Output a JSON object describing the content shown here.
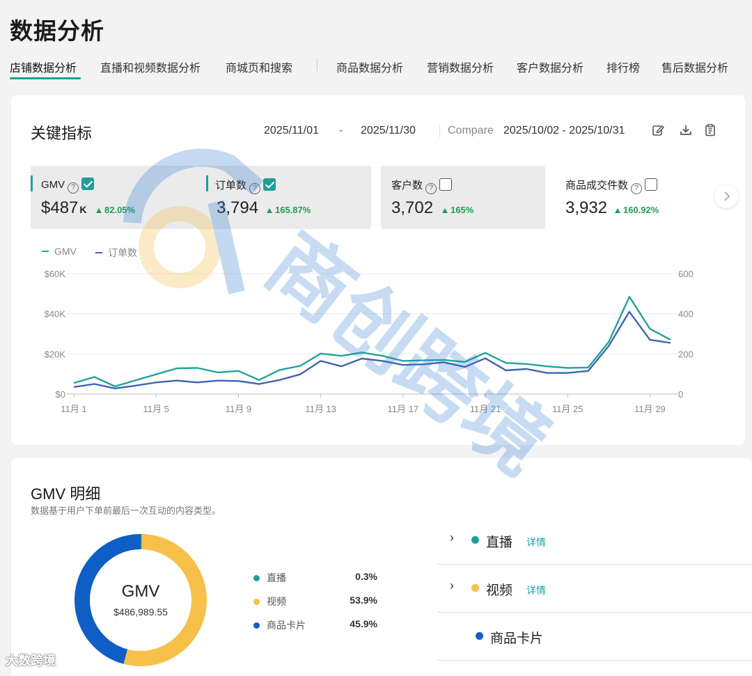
{
  "page": {
    "title": "数据分析"
  },
  "tabs": [
    {
      "label": "店铺数据分析"
    },
    {
      "label": "直播和视频数据分析"
    },
    {
      "label": "商城页和搜索"
    },
    {
      "label": "商品数据分析"
    },
    {
      "label": "营销数据分析"
    },
    {
      "label": "客户数据分析"
    },
    {
      "label": "排行榜"
    },
    {
      "label": "售后数据分析"
    }
  ],
  "key_metrics": {
    "title": "关键指标",
    "date_start": "2025/11/01",
    "date_dash": "-",
    "date_end": "2025/11/30",
    "compare_label": "Compare",
    "compare_range": "2025/10/02 - 2025/10/31",
    "icons": [
      "edit-icon",
      "download-icon",
      "clipboard-icon"
    ],
    "metrics": [
      {
        "label": "GMV",
        "value": "$487",
        "unit": "K",
        "delta": "82.05%",
        "checked": true,
        "selected": true
      },
      {
        "label": "订单数",
        "value": "3,794",
        "unit": "",
        "delta": "165.87%",
        "checked": true,
        "selected": true
      },
      {
        "label": "客户数",
        "value": "3,702",
        "unit": "",
        "delta": "165%",
        "checked": false,
        "selected": true
      },
      {
        "label": "商品成交件数",
        "value": "3,932",
        "unit": "",
        "delta": "160.92%",
        "checked": false,
        "selected": false
      }
    ],
    "help_glyph": "?"
  },
  "colors": {
    "accent": "#1f9e99",
    "gmv_line": "#22a39a",
    "orders_line": "#3f63b4",
    "positive": "#1d9e56",
    "live": "#1f9e99",
    "video": "#f7c04a",
    "product_card": "#0e5ec5"
  },
  "chart_data": {
    "type": "line",
    "legend": [
      "GMV",
      "订单数"
    ],
    "x": [
      "11月 1",
      "11月 2",
      "11月 3",
      "11月 4",
      "11月 5",
      "11月 6",
      "11月 7",
      "11月 8",
      "11月 9",
      "11月 10",
      "11月 11",
      "11月 12",
      "11月 13",
      "11月 14",
      "11月 15",
      "11月 16",
      "11月 17",
      "11月 18",
      "11月 19",
      "11月 20",
      "11月 21",
      "11月 22",
      "11月 23",
      "11月 24",
      "11月 25",
      "11月 26",
      "11月 27",
      "11月 28",
      "11月 29",
      "11月 30"
    ],
    "x_tick_labels": [
      "11月 1",
      "11月 5",
      "11月 9",
      "11月 13",
      "11月 17",
      "11月 21",
      "11月 25",
      "11月 29"
    ],
    "series": [
      {
        "name": "GMV",
        "axis": "left",
        "values": [
          5500,
          8500,
          3800,
          6800,
          9800,
          12800,
          13000,
          10800,
          11500,
          7000,
          12000,
          14000,
          20200,
          19000,
          20700,
          19000,
          16500,
          16800,
          17000,
          16000,
          20500,
          15500,
          15000,
          13800,
          13000,
          13200,
          26000,
          48500,
          32500,
          27000
        ]
      },
      {
        "name": "订单数",
        "axis": "left",
        "values": [
          3500,
          5000,
          2800,
          4200,
          5800,
          6700,
          5800,
          6700,
          6500,
          5000,
          7000,
          9800,
          16500,
          13800,
          17700,
          16500,
          14500,
          14800,
          15800,
          13500,
          17800,
          11800,
          12500,
          10500,
          10500,
          11500,
          24000,
          41000,
          27000,
          25500
        ]
      }
    ],
    "y_left": {
      "ticks": [
        "$0",
        "$20K",
        "$40K",
        "$60K"
      ],
      "lim": [
        0,
        60000
      ]
    },
    "y_right": {
      "ticks": [
        "0",
        "200",
        "400",
        "600"
      ],
      "lim": [
        0,
        600
      ]
    },
    "grid": true,
    "legend_position": "top-left"
  },
  "gmv_detail": {
    "title": "GMV 明细",
    "subtitle": "数据基于用户下单前最后一次互动的内容类型。",
    "donut_label": "GMV",
    "donut_value": "$486,989.55",
    "breakdown": [
      {
        "label": "直播",
        "pct": "0.3%",
        "value": 0.3,
        "color": "#1f9e99"
      },
      {
        "label": "视频",
        "pct": "53.9%",
        "value": 53.9,
        "color": "#f7c04a"
      },
      {
        "label": "商品卡片",
        "pct": "45.9%",
        "value": 45.9,
        "color": "#0e5ec5"
      }
    ],
    "channels": [
      {
        "label": "直播",
        "detail": "详情",
        "expandable": true
      },
      {
        "label": "视频",
        "detail": "详情",
        "expandable": true
      },
      {
        "label": "商品卡片",
        "detail": "",
        "expandable": false
      }
    ]
  },
  "watermarks": {
    "center": "商创跨境",
    "bottom": "大数跨境"
  }
}
